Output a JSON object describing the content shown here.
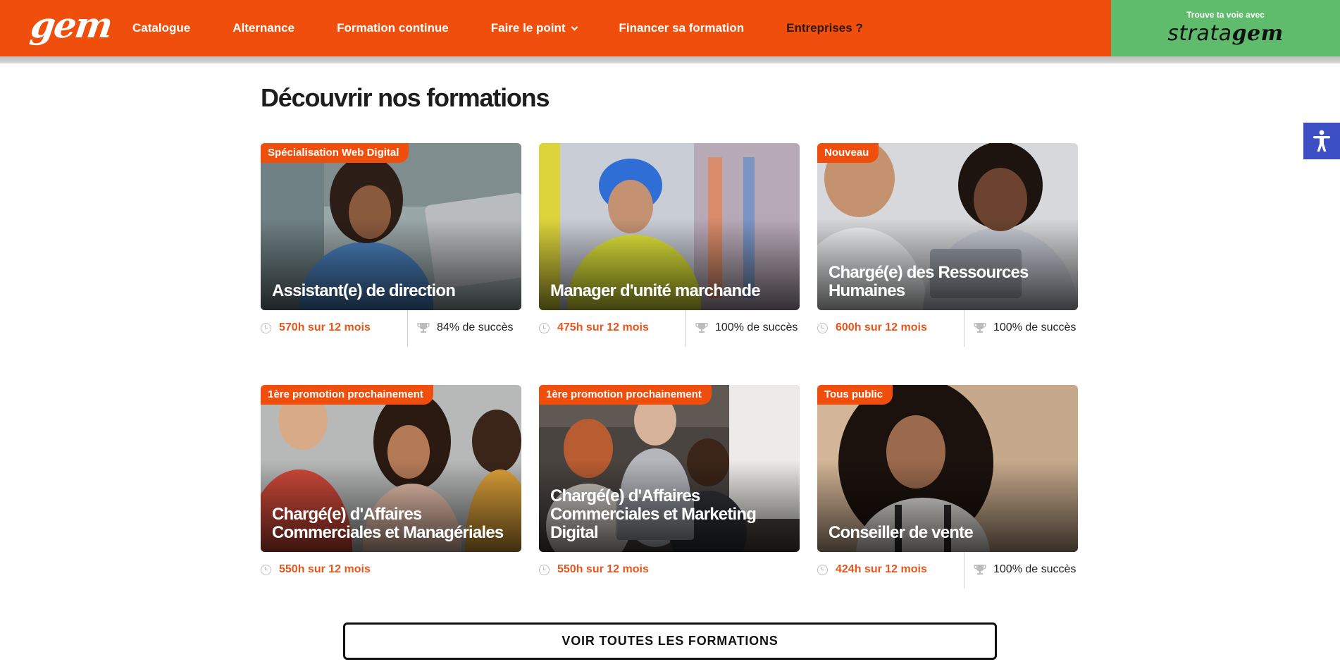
{
  "header": {
    "logo": "gem",
    "nav": [
      {
        "label": "Catalogue"
      },
      {
        "label": "Alternance"
      },
      {
        "label": "Formation continue"
      },
      {
        "label": "Faire le point"
      },
      {
        "label": "Financer sa formation"
      },
      {
        "label": "Entreprises ?"
      }
    ],
    "strata": {
      "tagline": "Trouve ta voie avec",
      "brand_a": "strata",
      "brand_b": "gem"
    }
  },
  "section": {
    "title": "Découvrir nos formations"
  },
  "cards": [
    {
      "badge": "Spécialisation Web Digital",
      "title": "Assistant(e) de direction",
      "hours": "570h sur 12 mois",
      "success": "84% de succès"
    },
    {
      "badge": "",
      "title": "Manager d'unité marchande",
      "hours": "475h sur 12 mois",
      "success": "100% de succès"
    },
    {
      "badge": "Nouveau",
      "title": "Chargé(e) des Ressources Humaines",
      "hours": "600h sur 12 mois",
      "success": "100% de succès"
    },
    {
      "badge": "1ère promotion prochainement",
      "title": "Chargé(e) d'Affaires Commerciales et Managériales",
      "hours": "550h sur 12 mois",
      "success": ""
    },
    {
      "badge": "1ère promotion prochainement",
      "title": "Chargé(e) d'Affaires Commerciales et Marketing Digital",
      "hours": "550h sur 12 mois",
      "success": ""
    },
    {
      "badge": "Tous public",
      "title": "Conseiller de vente",
      "hours": "424h sur 12 mois",
      "success": "100% de succès"
    }
  ],
  "cta": {
    "label": "VOIR TOUTES LES FORMATIONS"
  },
  "colors": {
    "brand": "#f04e0c",
    "strata": "#5ebc6c",
    "accessibility": "#3d4fc4"
  }
}
